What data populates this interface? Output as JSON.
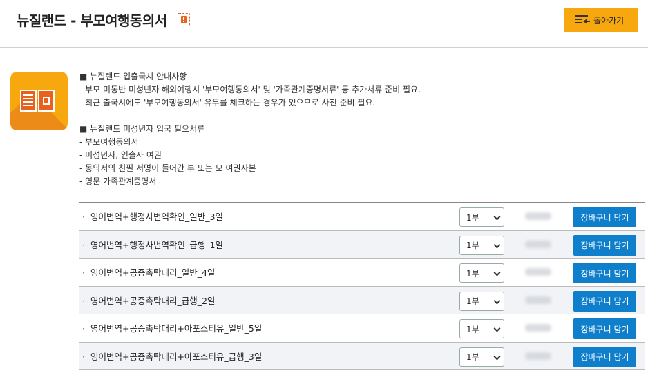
{
  "header": {
    "title": "뉴질랜드 - 부모여행동의서",
    "back_label": "돌아가기"
  },
  "notice": {
    "section1_title": "■ 뉴질랜드 입출국시 안내사항",
    "section1_lines": [
      "- 부모 미동반 미성년자 해외여행시 '부모여행동의서' 및 '가족관계증명서류' 등 추가서류 준비 필요.",
      "- 최근 출국시에도 '부모여행동의서' 유무를 체크하는 경우가 있으므로 사전 준비 필요."
    ],
    "section2_title": "■ 뉴질랜드 미성년자 입국 필요서류",
    "section2_lines": [
      "- 부모여행동의서",
      "- 미성년자, 인솔자 여권",
      "- 동의서의 친필 서명이 들어간 부 또는 모 여권사본",
      "- 영문 가족관계증명서"
    ]
  },
  "products": [
    {
      "name": "영어번역+행정사번역확인_일반_3일",
      "qty": "1부",
      "cart_label": "장바구니 담기"
    },
    {
      "name": "영어번역+행정사번역확인_급행_1일",
      "qty": "1부",
      "cart_label": "장바구니 담기"
    },
    {
      "name": "영어번역+공증촉탁대리_일반_4일",
      "qty": "1부",
      "cart_label": "장바구니 담기"
    },
    {
      "name": "영어번역+공증촉탁대리_급행_2일",
      "qty": "1부",
      "cart_label": "장바구니 담기"
    },
    {
      "name": "영어번역+공증촉탁대리+아포스티유_일반_5일",
      "qty": "1부",
      "cart_label": "장바구니 담기"
    },
    {
      "name": "영어번역+공증촉탁대리+아포스티유_급행_3일",
      "qty": "1부",
      "cart_label": "장바구니 담기"
    }
  ],
  "colors": {
    "accent_orange": "#f7a80f",
    "cart_blue": "#0f7ecb",
    "alert_orange": "#e8621c"
  },
  "icons": {
    "alert": "alert-icon",
    "back": "list-back-icon",
    "document": "document-icon",
    "dropdown": "chevron-down-icon"
  }
}
